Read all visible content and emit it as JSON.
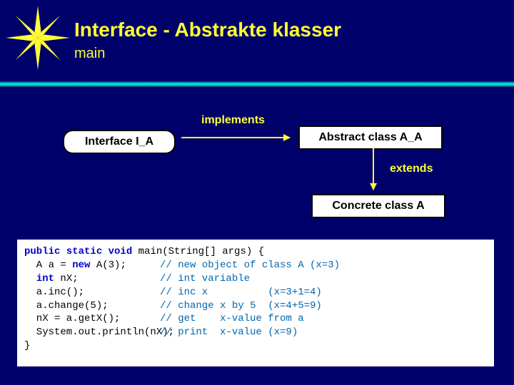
{
  "title": "Interface   -   Abstrakte klasser",
  "subtitle": "main",
  "labels": {
    "implements": "implements",
    "extends": "extends"
  },
  "boxes": {
    "interface": "Interface   I_A",
    "abstract": "Abstract class   A_A",
    "concrete": "Concrete class   A"
  },
  "code": {
    "kw_sig": "public static void",
    "sig_rest": " main(String[] args) {",
    "lines": [
      {
        "l": "",
        "r": ""
      },
      {
        "l": "  A a = ",
        "kw": "new",
        "l2": " A(3);",
        "r": "// new object of class A (x=3)"
      },
      {
        "l": "  ",
        "kw": "int",
        "l2": " nX;",
        "r": "// int variable"
      },
      {
        "l": "",
        "r": ""
      },
      {
        "l": "  a.inc();",
        "r": "// inc x          (x=3+1=4)"
      },
      {
        "l": "  a.change(5);",
        "r": "// change x by 5  (x=4+5=9)"
      },
      {
        "l": "  nX = a.getX();",
        "r": "// get    x-value from a"
      },
      {
        "l": "  System.out.println(nX);",
        "r": "// print  x-value (x=9)"
      }
    ],
    "close": "}"
  }
}
